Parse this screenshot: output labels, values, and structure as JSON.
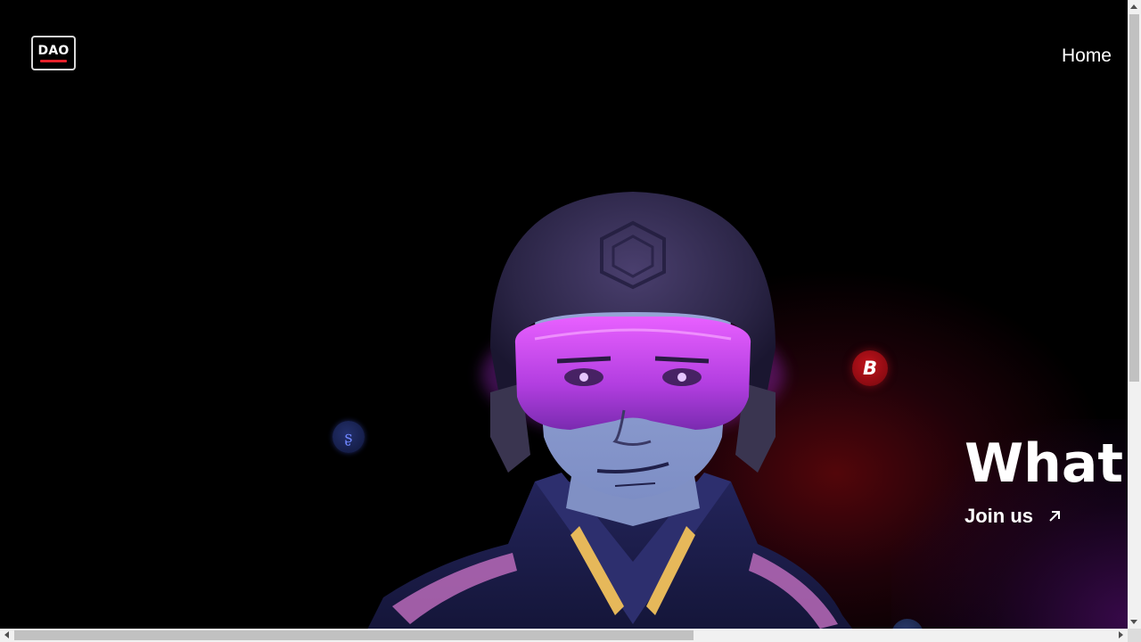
{
  "header": {
    "logo_text": "DAO",
    "nav": {
      "home_label": "Home"
    }
  },
  "hero": {
    "headline": "What is",
    "join_label": "Join us",
    "join_icon": "arrow-up-right-icon",
    "illustration": "helmeted-character-with-purple-visor"
  },
  "floating_coins": [
    {
      "icon": "b-token-icon",
      "letter": "B",
      "color": "#b0101a"
    },
    {
      "icon": "blue-token-icon",
      "glyph": "ʂ",
      "color": "#2a3a8a"
    },
    {
      "icon": "blue-token-partial-icon",
      "color": "#233166"
    }
  ],
  "colors": {
    "background": "#000000",
    "accent_red": "#e5212b",
    "visor_purple": "#c447f0",
    "text": "#ffffff"
  }
}
